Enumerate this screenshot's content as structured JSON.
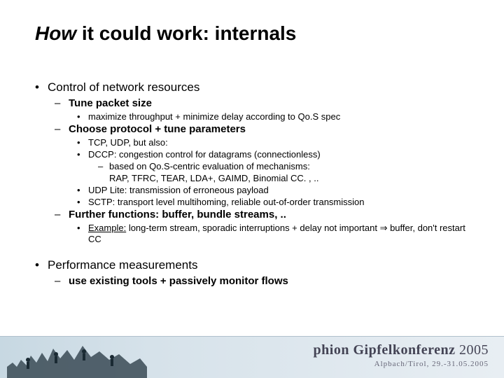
{
  "title_italic": "How",
  "title_rest": " it could work: internals",
  "sec1": {
    "heading": "Control of network resources",
    "item1": {
      "label": "Tune packet size",
      "sub1": "maximize throughput + minimize delay according to Qo.S spec"
    },
    "item2": {
      "label": "Choose protocol + tune parameters",
      "sub1": "TCP, UDP, but also:",
      "sub2": "DCCP: congestion control for datagrams (connectionless)",
      "sub2a": "based on Qo.S-centric evaluation of mechanisms:",
      "sub2a_cont": "RAP, TFRC, TEAR, LDA+, GAIMD, Binomial CC. , ..",
      "sub3": "UDP Lite: transmission of erroneous payload",
      "sub4": "SCTP: transport level multihoming, reliable out-of-order transmission"
    },
    "item3": {
      "label": "Further functions: buffer, bundle streams, ..",
      "sub1_underline": "Example:",
      "sub1_rest": " long-term stream, sporadic interruptions + delay not important ⇒ buffer, don't restart CC"
    }
  },
  "sec2": {
    "heading": "Performance measurements",
    "item1": {
      "label": "use existing tools + passively monitor flows"
    }
  },
  "footer": {
    "brand": "phion",
    "conf": "Gipfelkonferenz",
    "year": "2005",
    "loc": "Alpbach/Tirol, 29.-31.05.2005"
  }
}
